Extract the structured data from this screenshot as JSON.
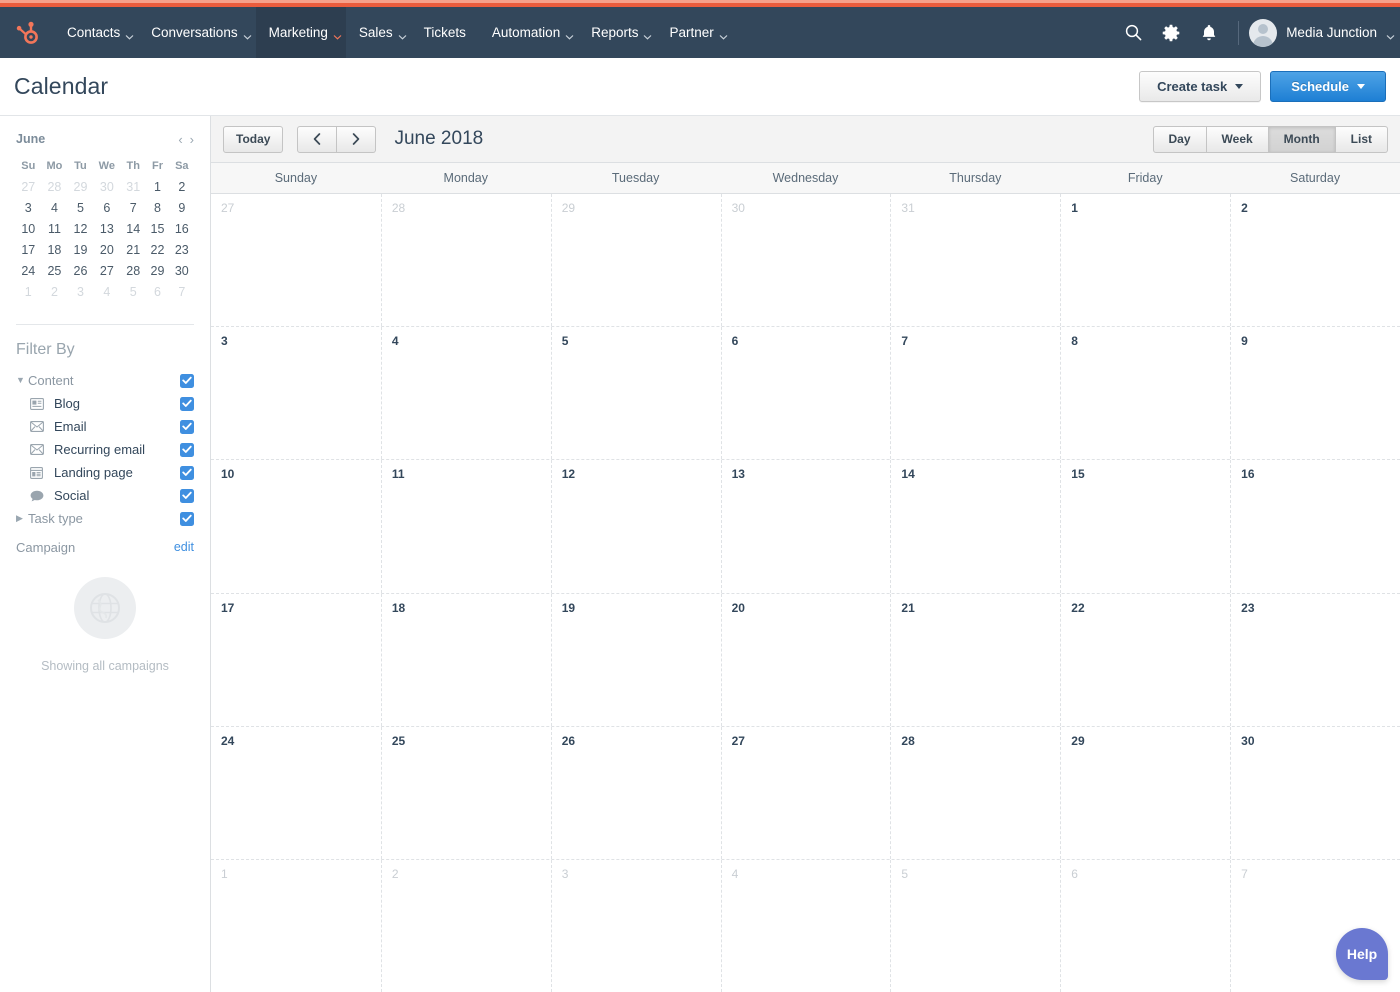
{
  "theme": {
    "accent_top": "#f5a18b",
    "accent_bar": "#ea5c3d",
    "nav_bg": "#33475b",
    "primary_blue": "#1e7fd4",
    "checkbox_blue": "#3f8fe0",
    "link_blue": "#3f8fe0",
    "help_purple": "#6a78d1"
  },
  "globalnav": {
    "logo": "hubspot-sprocket-logo",
    "items": [
      {
        "label": "Contacts",
        "has_caret": true,
        "active": false
      },
      {
        "label": "Conversations",
        "has_caret": true,
        "active": false
      },
      {
        "label": "Marketing",
        "has_caret": true,
        "active": true
      },
      {
        "label": "Sales",
        "has_caret": true,
        "active": false
      },
      {
        "label": "Tickets",
        "has_caret": false,
        "active": false
      },
      {
        "label": "Automation",
        "has_caret": true,
        "active": false
      },
      {
        "label": "Reports",
        "has_caret": true,
        "active": false
      },
      {
        "label": "Partner",
        "has_caret": true,
        "active": false
      }
    ],
    "icons": [
      "search-icon",
      "gear-icon",
      "bell-icon"
    ],
    "account_name": "Media Junction"
  },
  "pageheader": {
    "title": "Calendar",
    "create_task_label": "Create task",
    "schedule_label": "Schedule"
  },
  "sidebar": {
    "minicalendar": {
      "month_label": "June",
      "prev_glyph": "‹",
      "next_glyph": "›",
      "weekday_headers": [
        "Su",
        "Mo",
        "Tu",
        "We",
        "Th",
        "Fr",
        "Sa"
      ],
      "weeks": [
        [
          {
            "d": "27",
            "muted": true
          },
          {
            "d": "28",
            "muted": true
          },
          {
            "d": "29",
            "muted": true
          },
          {
            "d": "30",
            "muted": true
          },
          {
            "d": "31",
            "muted": true
          },
          {
            "d": "1",
            "muted": false
          },
          {
            "d": "2",
            "muted": false
          }
        ],
        [
          {
            "d": "3",
            "muted": false
          },
          {
            "d": "4",
            "muted": false
          },
          {
            "d": "5",
            "muted": false
          },
          {
            "d": "6",
            "muted": false
          },
          {
            "d": "7",
            "muted": false
          },
          {
            "d": "8",
            "muted": false
          },
          {
            "d": "9",
            "muted": false
          }
        ],
        [
          {
            "d": "10",
            "muted": false
          },
          {
            "d": "11",
            "muted": false
          },
          {
            "d": "12",
            "muted": false
          },
          {
            "d": "13",
            "muted": false
          },
          {
            "d": "14",
            "muted": false
          },
          {
            "d": "15",
            "muted": false
          },
          {
            "d": "16",
            "muted": false
          }
        ],
        [
          {
            "d": "17",
            "muted": false
          },
          {
            "d": "18",
            "muted": false
          },
          {
            "d": "19",
            "muted": false
          },
          {
            "d": "20",
            "muted": false
          },
          {
            "d": "21",
            "muted": false
          },
          {
            "d": "22",
            "muted": false
          },
          {
            "d": "23",
            "muted": false
          }
        ],
        [
          {
            "d": "24",
            "muted": false
          },
          {
            "d": "25",
            "muted": false
          },
          {
            "d": "26",
            "muted": false
          },
          {
            "d": "27",
            "muted": false
          },
          {
            "d": "28",
            "muted": false
          },
          {
            "d": "29",
            "muted": false
          },
          {
            "d": "30",
            "muted": false
          }
        ],
        [
          {
            "d": "1",
            "muted": true
          },
          {
            "d": "2",
            "muted": true
          },
          {
            "d": "3",
            "muted": true
          },
          {
            "d": "4",
            "muted": true
          },
          {
            "d": "5",
            "muted": true
          },
          {
            "d": "6",
            "muted": true
          },
          {
            "d": "7",
            "muted": true
          }
        ]
      ]
    },
    "filter": {
      "heading": "Filter By",
      "rows": [
        {
          "label": "Content",
          "kind": "group",
          "twisty": "expanded",
          "icon": null,
          "checked": true
        },
        {
          "label": "Blog",
          "kind": "child",
          "twisty": null,
          "icon": "newspaper-icon",
          "checked": true
        },
        {
          "label": "Email",
          "kind": "child",
          "twisty": null,
          "icon": "envelope-icon",
          "checked": true
        },
        {
          "label": "Recurring email",
          "kind": "child",
          "twisty": null,
          "icon": "envelope-icon",
          "checked": true
        },
        {
          "label": "Landing page",
          "kind": "child",
          "twisty": null,
          "icon": "landing-page-icon",
          "checked": true
        },
        {
          "label": "Social",
          "kind": "child",
          "twisty": null,
          "icon": "speech-bubble-icon",
          "checked": true
        },
        {
          "label": "Task type",
          "kind": "group",
          "twisty": "collapsed",
          "icon": null,
          "checked": true
        }
      ]
    },
    "campaign": {
      "label": "Campaign",
      "edit_label": "edit",
      "empty_icon": "globe-icon",
      "empty_text": "Showing all campaigns"
    }
  },
  "calendar": {
    "toolbar": {
      "today_label": "Today",
      "prev_glyph": "‹",
      "next_glyph": "›",
      "period_title": "June 2018",
      "views": [
        {
          "label": "Day",
          "active": false
        },
        {
          "label": "Week",
          "active": false
        },
        {
          "label": "Month",
          "active": true
        },
        {
          "label": "List",
          "active": false
        }
      ]
    },
    "day_headers": [
      "Sunday",
      "Monday",
      "Tuesday",
      "Wednesday",
      "Thursday",
      "Friday",
      "Saturday"
    ],
    "weeks": [
      [
        {
          "d": "27",
          "other": true
        },
        {
          "d": "28",
          "other": true
        },
        {
          "d": "29",
          "other": true
        },
        {
          "d": "30",
          "other": true
        },
        {
          "d": "31",
          "other": true
        },
        {
          "d": "1",
          "other": false
        },
        {
          "d": "2",
          "other": false
        }
      ],
      [
        {
          "d": "3",
          "other": false
        },
        {
          "d": "4",
          "other": false
        },
        {
          "d": "5",
          "other": false
        },
        {
          "d": "6",
          "other": false
        },
        {
          "d": "7",
          "other": false
        },
        {
          "d": "8",
          "other": false
        },
        {
          "d": "9",
          "other": false
        }
      ],
      [
        {
          "d": "10",
          "other": false
        },
        {
          "d": "11",
          "other": false
        },
        {
          "d": "12",
          "other": false
        },
        {
          "d": "13",
          "other": false
        },
        {
          "d": "14",
          "other": false
        },
        {
          "d": "15",
          "other": false
        },
        {
          "d": "16",
          "other": false
        }
      ],
      [
        {
          "d": "17",
          "other": false
        },
        {
          "d": "18",
          "other": false
        },
        {
          "d": "19",
          "other": false
        },
        {
          "d": "20",
          "other": false
        },
        {
          "d": "21",
          "other": false
        },
        {
          "d": "22",
          "other": false
        },
        {
          "d": "23",
          "other": false
        }
      ],
      [
        {
          "d": "24",
          "other": false
        },
        {
          "d": "25",
          "other": false
        },
        {
          "d": "26",
          "other": false
        },
        {
          "d": "27",
          "other": false
        },
        {
          "d": "28",
          "other": false
        },
        {
          "d": "29",
          "other": false
        },
        {
          "d": "30",
          "other": false
        }
      ],
      [
        {
          "d": "1",
          "other": true
        },
        {
          "d": "2",
          "other": true
        },
        {
          "d": "3",
          "other": true
        },
        {
          "d": "4",
          "other": true
        },
        {
          "d": "5",
          "other": true
        },
        {
          "d": "6",
          "other": true
        },
        {
          "d": "7",
          "other": true
        }
      ]
    ],
    "events": []
  },
  "help": {
    "label": "Help"
  }
}
